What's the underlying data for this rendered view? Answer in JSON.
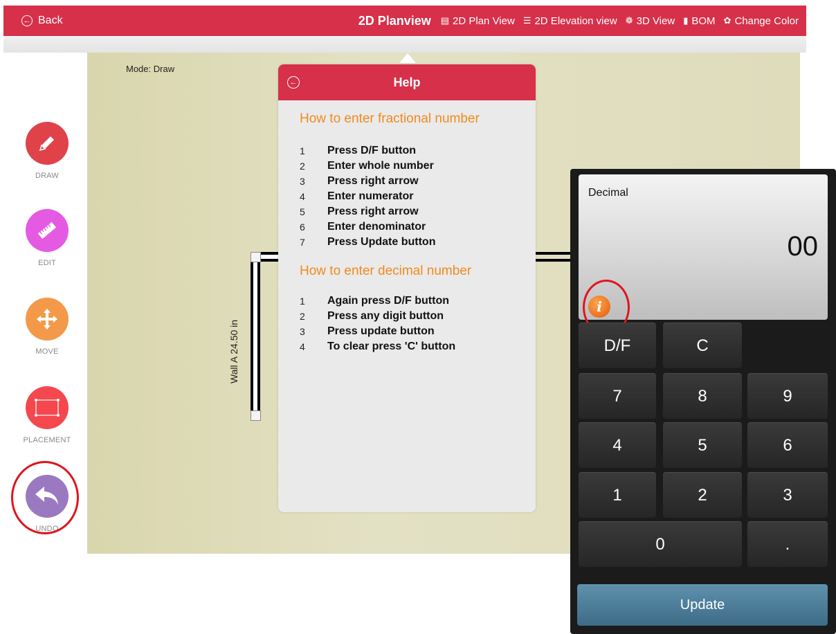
{
  "topbar": {
    "back_label": "Back",
    "title": "2D Planview",
    "nav": [
      {
        "label": "2D Plan View",
        "icon": "plan-view-icon"
      },
      {
        "label": "2D Elevation view",
        "icon": "elevation-view-icon"
      },
      {
        "label": "3D View",
        "icon": "3d-view-icon"
      },
      {
        "label": "BOM",
        "icon": "document-icon"
      },
      {
        "label": "Change Color",
        "icon": "palette-icon"
      }
    ],
    "color": "#d7304a"
  },
  "toolbar": {
    "items": [
      {
        "label": "DRAW",
        "color": "#e0424a",
        "icon": "pencil-icon"
      },
      {
        "label": "EDIT",
        "color": "#e55ae2",
        "icon": "ruler-icon"
      },
      {
        "label": "MOVE",
        "color": "#f39a4a",
        "icon": "move-arrows-icon"
      },
      {
        "label": "PLACEMENT",
        "color": "#f4484e",
        "icon": "placement-rect-icon"
      },
      {
        "label": "UNDO",
        "color": "#9b79c0",
        "icon": "undo-arrow-icon"
      }
    ]
  },
  "canvas": {
    "mode": "Mode: Draw",
    "wall_label": "Wall A 24.50 in"
  },
  "help": {
    "title": "Help",
    "fraction_heading": "How to enter fractional number",
    "fraction_steps": [
      {
        "n": "1",
        "text": "Press D/F button"
      },
      {
        "n": "2",
        "text": "Enter whole number"
      },
      {
        "n": "3",
        "text": "Press right arrow"
      },
      {
        "n": "4",
        "text": "Enter numerator"
      },
      {
        "n": "5",
        "text": "Press right arrow"
      },
      {
        "n": "6",
        "text": "Enter denominator"
      },
      {
        "n": "7",
        "text": "Press Update button"
      }
    ],
    "decimal_heading": "How to enter decimal number",
    "decimal_steps": [
      {
        "n": "1",
        "text": "Again press D/F button"
      },
      {
        "n": "2",
        "text": "Press any digit button"
      },
      {
        "n": "3",
        "text": "Press update button"
      },
      {
        "n": "4",
        "text": "To clear press 'C' button"
      }
    ],
    "heading_color": "#f08a1e"
  },
  "calculator": {
    "mode_label": "Decimal",
    "value": "00",
    "info_glyph": "i",
    "keys": {
      "df": "D/F",
      "clear": "C",
      "k7": "7",
      "k8": "8",
      "k9": "9",
      "k4": "4",
      "k5": "5",
      "k6": "6",
      "k1": "1",
      "k2": "2",
      "k3": "3",
      "k0": "0",
      "dot": "."
    },
    "update_label": "Update"
  }
}
